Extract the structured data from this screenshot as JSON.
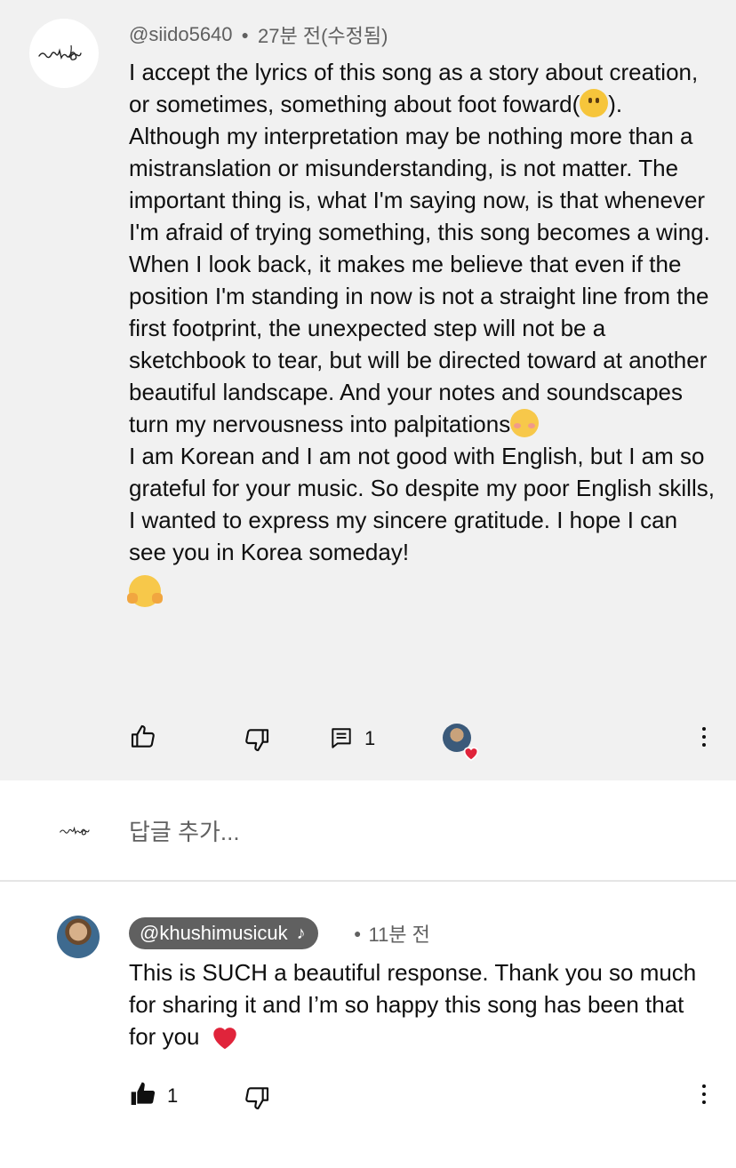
{
  "comment": {
    "author": "@siido5640",
    "time": "27분 전(수정됨)",
    "paragraphs": [
      {
        "text": "I accept the lyrics of this song as a story about creation, or sometimes, something about foot foward(",
        "emoji": "slightly-smiling-face",
        "after": ")."
      },
      {
        "text": "Although my interpretation may be nothing more than a mistranslation or misunderstanding, is not matter. The important thing is, what I'm saying now, is that whenever I'm afraid of trying something, this song becomes a wing. When I look back, it makes me believe that even if the position I'm standing in now is not a straight line from the first footprint, the unexpected step will not be a sketchbook to tear, but will be directed toward at another beautiful landscape. And your notes and soundscapes turn my nervousness into palpitations",
        "emoji": "smiling-face",
        "after": ""
      },
      {
        "text": "I am Korean and I am not good with English, but I am so grateful for your music. So despite my poor English skills, I wanted to express my sincere gratitude. I hope I can see you in Korea someday!",
        "emoji": "hugging-face",
        "after": ""
      }
    ],
    "reply_count": "1",
    "icons": {
      "like": "thumbs-up-outline-icon",
      "dislike": "thumbs-down-outline-icon",
      "replies": "comment-icon",
      "more": "more-vertical-icon",
      "creator_heart": "creator-heart-icon"
    }
  },
  "reply_box": {
    "placeholder": "답글 추가..."
  },
  "reply": {
    "author": "@khushimusicuk",
    "author_badge_icon": "music-note-icon",
    "time": "11분 전",
    "text": "This is SUCH a beautiful response. Thank you so much for sharing it and I’m so happy this song has been that for you",
    "emoji": "red-heart",
    "like_count": "1"
  },
  "colors": {
    "top_background": "#f1f1f1",
    "text": "#0f0f0f",
    "secondary_text": "#606060",
    "creator_chip": "#606060",
    "heart": "#e0243b"
  }
}
